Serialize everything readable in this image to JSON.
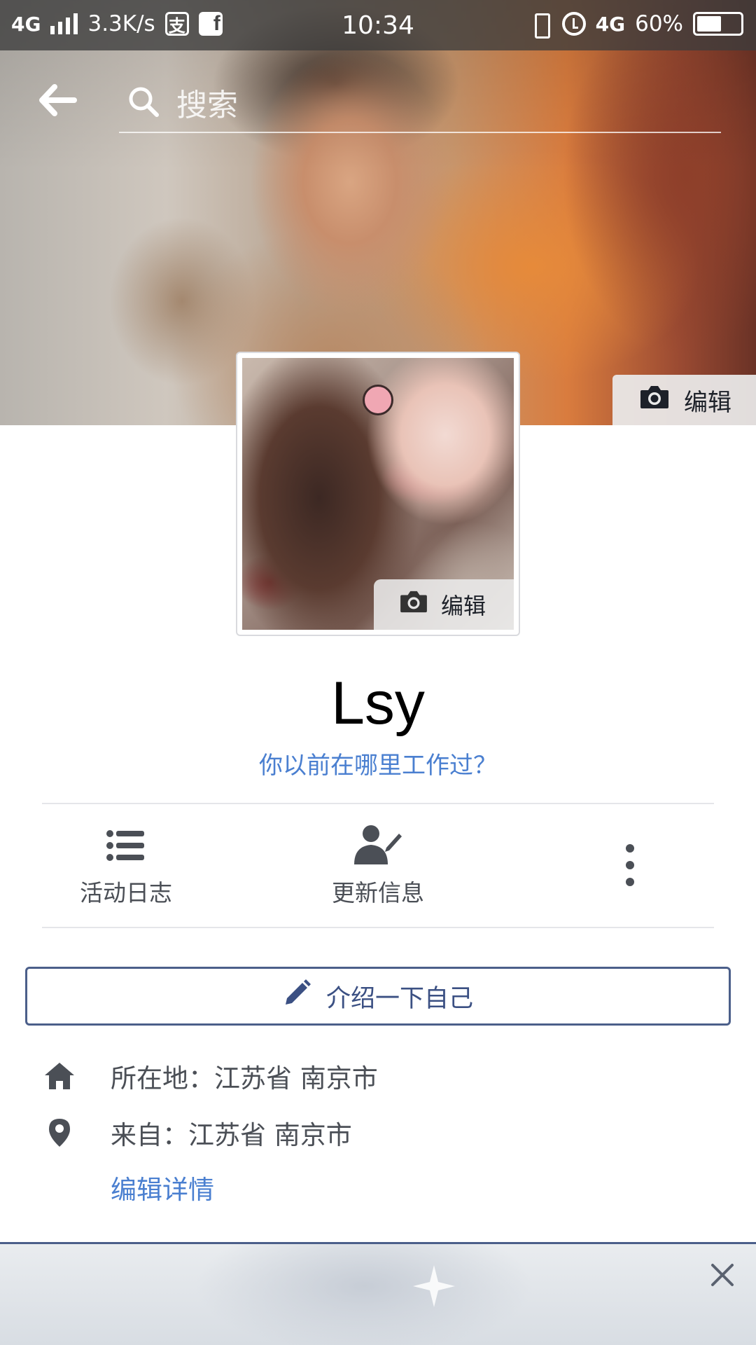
{
  "status_bar": {
    "network": "4G",
    "speed": "3.3K/s",
    "time": "10:34",
    "network_right": "4G",
    "battery": "60%",
    "battery_level": 0.6,
    "icons": [
      "signal-icon",
      "alipay-icon",
      "facebook-icon",
      "vibrate-icon",
      "alarm-icon",
      "battery-icon"
    ]
  },
  "header": {
    "search_placeholder": "搜索"
  },
  "cover": {
    "edit_label": "编辑"
  },
  "avatar": {
    "edit_label": "编辑"
  },
  "profile": {
    "name": "Lsy",
    "work_prompt": "你以前在哪里工作过？"
  },
  "actions": [
    {
      "label": "活动日志",
      "icon": "list-icon"
    },
    {
      "label": "更新信息",
      "icon": "person-edit-icon"
    }
  ],
  "intro_button": {
    "label": "介绍一下自己",
    "icon": "pencil-icon"
  },
  "info": {
    "lives_in": "所在地：江苏省 南京市",
    "from": "来自：江苏省 南京市",
    "edit_details": "编辑详情"
  },
  "colors": {
    "link": "#4a7fd0",
    "border_accent": "#4b5f8a",
    "text_gray": "#4b4f56"
  }
}
